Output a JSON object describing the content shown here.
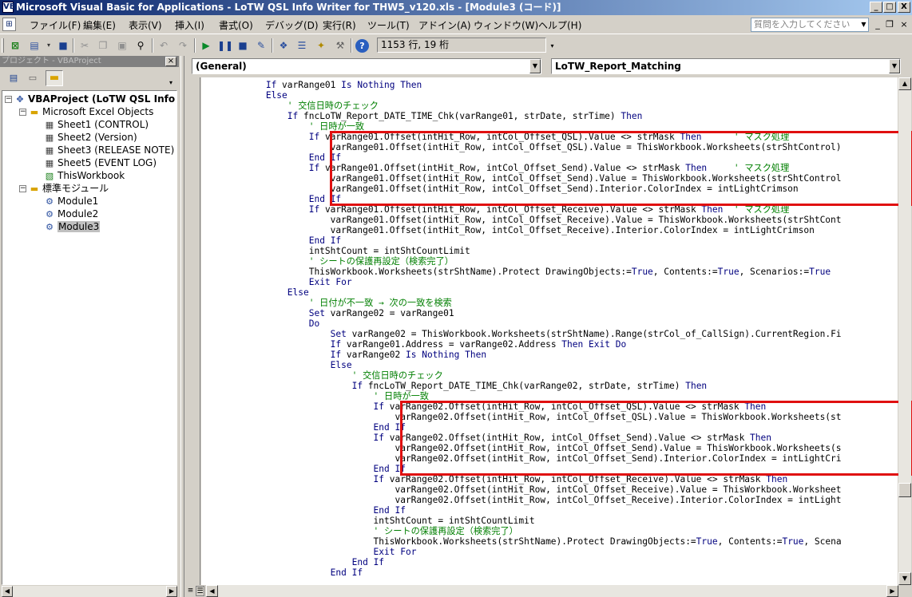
{
  "window": {
    "title": "Microsoft Visual Basic for Applications - LoTW QSL Info Writer for THW5_v120.xls - [Module3 (コード)]",
    "app_icon_symbol": "VB",
    "minimize": "_",
    "maximize": "□",
    "close": "X"
  },
  "menu": {
    "items": [
      "ファイル(F)",
      "編集(E)",
      "表示(V)",
      "挿入(I)",
      "書式(O)",
      "デバッグ(D)",
      "実行(R)",
      "ツール(T)",
      "アドイン(A)",
      "ウィンドウ(W)",
      "ヘルプ(H)"
    ],
    "help_placeholder": "質問を入力してください",
    "mdi_minimize": "_",
    "mdi_restore": "❐",
    "mdi_close": "×"
  },
  "toolbar": {
    "icons": [
      "excel-icon",
      "insert-userform-icon",
      "save-icon",
      "cut-icon",
      "copy-icon",
      "paste-icon",
      "find-icon",
      "undo-icon",
      "redo-icon",
      "run-icon",
      "break-icon",
      "reset-icon",
      "design-mode-icon",
      "project-explorer-icon",
      "properties-icon",
      "object-browser-icon",
      "toolbox-icon",
      "help-icon"
    ],
    "position": "1153 行, 19 桁"
  },
  "project": {
    "title": "プロジェクト - VBAProject",
    "close": "×",
    "tree": [
      {
        "label": "VBAProject (LoTW QSL Info W",
        "level": 0,
        "expander": "−",
        "icon": "vbaproject-icon",
        "bold": true
      },
      {
        "label": "Microsoft Excel Objects",
        "level": 1,
        "expander": "−",
        "icon": "folder-icon"
      },
      {
        "label": "Sheet1 (CONTROL)",
        "level": 2,
        "icon": "sheet-icon"
      },
      {
        "label": "Sheet2 (Version)",
        "level": 2,
        "icon": "sheet-icon"
      },
      {
        "label": "Sheet3 (RELEASE NOTE)",
        "level": 2,
        "icon": "sheet-icon"
      },
      {
        "label": "Sheet5 (EVENT LOG)",
        "level": 2,
        "icon": "sheet-icon"
      },
      {
        "label": "ThisWorkbook",
        "level": 2,
        "icon": "workbook-icon"
      },
      {
        "label": "標準モジュール",
        "level": 1,
        "expander": "−",
        "icon": "folder-icon"
      },
      {
        "label": "Module1",
        "level": 2,
        "icon": "module-icon"
      },
      {
        "label": "Module2",
        "level": 2,
        "icon": "module-icon"
      },
      {
        "label": "Module3",
        "level": 2,
        "icon": "module-icon",
        "selected": true
      }
    ]
  },
  "code": {
    "object_combo": "(General)",
    "procedure_combo": "LoTW_Report_Matching",
    "lines": [
      [
        [
          " ",
          "            If varRange01 Is Nothing Then"
        ]
      ],
      [
        [
          " ",
          "            Else"
        ]
      ],
      [
        [
          "c",
          "                ' 交信日時のチェック"
        ]
      ],
      [
        [
          " ",
          "                If fncLoTW_Report_DATE_TIME_Chk(varRange01, strDate, strTime) Then"
        ]
      ],
      [
        [
          "c",
          "                    ' 日時が一致"
        ]
      ],
      [
        [
          " ",
          "                    If varRange01.Offset(intHit_Row, intCol_Offset_QSL).Value <> strMask Then      "
        ],
        [
          "c",
          "' マスク処理"
        ]
      ],
      [
        [
          " ",
          "                        varRange01.Offset(intHit_Row, intCol_Offset_QSL).Value = ThisWorkbook.Worksheets(strShtControl)"
        ]
      ],
      [
        [
          " ",
          "                    End If"
        ]
      ],
      [
        [
          " ",
          "                    If varRange01.Offset(intHit_Row, intCol_Offset_Send).Value <> strMask Then     "
        ],
        [
          "c",
          "' マスク処理"
        ]
      ],
      [
        [
          " ",
          "                        varRange01.Offset(intHit_Row, intCol_Offset_Send).Value = ThisWorkbook.Worksheets(strShtControl"
        ]
      ],
      [
        [
          " ",
          "                        varRange01.Offset(intHit_Row, intCol_Offset_Send).Interior.ColorIndex = intLightCrimson"
        ]
      ],
      [
        [
          " ",
          "                    End If"
        ]
      ],
      [
        [
          " ",
          "                    If varRange01.Offset(intHit_Row, intCol_Offset_Receive).Value <> strMask Then  "
        ],
        [
          "c",
          "' マスク処理"
        ]
      ],
      [
        [
          " ",
          "                        varRange01.Offset(intHit_Row, intCol_Offset_Receive).Value = ThisWorkbook.Worksheets(strShtCont"
        ]
      ],
      [
        [
          " ",
          "                        varRange01.Offset(intHit_Row, intCol_Offset_Receive).Interior.ColorIndex = intLightCrimson"
        ]
      ],
      [
        [
          " ",
          "                    End If"
        ]
      ],
      [
        [
          " ",
          "                    intShtCount = intShtCountLimit"
        ]
      ],
      [
        [
          "c",
          "                    ' シートの保護再設定（検索完了）"
        ]
      ],
      [
        [
          " ",
          "                    ThisWorkbook.Worksheets(strShtName).Protect DrawingObjects:=True, Contents:=True, Scenarios:=True"
        ]
      ],
      [
        [
          " ",
          "                    Exit For"
        ]
      ],
      [
        [
          " ",
          "                Else"
        ]
      ],
      [
        [
          "c",
          "                    ' 日付が不一致 → 次の一致を検索"
        ]
      ],
      [
        [
          " ",
          "                    Set varRange02 = varRange01"
        ]
      ],
      [
        [
          " ",
          "                    Do"
        ]
      ],
      [
        [
          " ",
          "                        Set varRange02 = ThisWorkbook.Worksheets(strShtName).Range(strCol_of_CallSign).CurrentRegion.Fi"
        ]
      ],
      [
        [
          " ",
          "                        If varRange01.Address = varRange02.Address Then Exit Do"
        ]
      ],
      [
        [
          " ",
          "                        If varRange02 Is Nothing Then"
        ]
      ],
      [
        [
          " ",
          "                        Else"
        ]
      ],
      [
        [
          "c",
          "                            ' 交信日時のチェック"
        ]
      ],
      [
        [
          " ",
          "                            If fncLoTW_Report_DATE_TIME_Chk(varRange02, strDate, strTime) Then"
        ]
      ],
      [
        [
          "c",
          "                                ' 日時が一致"
        ]
      ],
      [
        [
          " ",
          "                                If varRange02.Offset(intHit_Row, intCol_Offset_QSL).Value <> strMask Then"
        ]
      ],
      [
        [
          " ",
          "                                    varRange02.Offset(intHit_Row, intCol_Offset_QSL).Value = ThisWorkbook.Worksheets(st"
        ]
      ],
      [
        [
          " ",
          "                                End If"
        ]
      ],
      [
        [
          " ",
          "                                If varRange02.Offset(intHit_Row, intCol_Offset_Send).Value <> strMask Then"
        ]
      ],
      [
        [
          " ",
          "                                    varRange02.Offset(intHit_Row, intCol_Offset_Send).Value = ThisWorkbook.Worksheets(s"
        ]
      ],
      [
        [
          " ",
          "                                    varRange02.Offset(intHit_Row, intCol_Offset_Send).Interior.ColorIndex = intLightCri"
        ]
      ],
      [
        [
          " ",
          "                                End If"
        ]
      ],
      [
        [
          " ",
          "                                If varRange02.Offset(intHit_Row, intCol_Offset_Receive).Value <> strMask Then"
        ]
      ],
      [
        [
          " ",
          "                                    varRange02.Offset(intHit_Row, intCol_Offset_Receive).Value = ThisWorkbook.Worksheet"
        ]
      ],
      [
        [
          " ",
          "                                    varRange02.Offset(intHit_Row, intCol_Offset_Receive).Interior.ColorIndex = intLight"
        ]
      ],
      [
        [
          " ",
          "                                End If"
        ]
      ],
      [
        [
          " ",
          "                                intShtCount = intShtCountLimit"
        ]
      ],
      [
        [
          "c",
          "                                ' シートの保護再設定（検索完了）"
        ]
      ],
      [
        [
          " ",
          "                                ThisWorkbook.Worksheets(strShtName).Protect DrawingObjects:=True, Contents:=True, Scena"
        ]
      ],
      [
        [
          " ",
          "                                Exit For"
        ]
      ],
      [
        [
          " ",
          "                            End If"
        ]
      ],
      [
        [
          " ",
          "                        End If"
        ]
      ]
    ]
  },
  "keywords": [
    "If",
    "Then",
    "Else",
    "End",
    "Is",
    "Nothing",
    "Set",
    "Do",
    "Exit",
    "For",
    "True"
  ],
  "colors": {
    "keyword": "#00007f",
    "comment": "#007f00",
    "highlight": "#e01010"
  }
}
